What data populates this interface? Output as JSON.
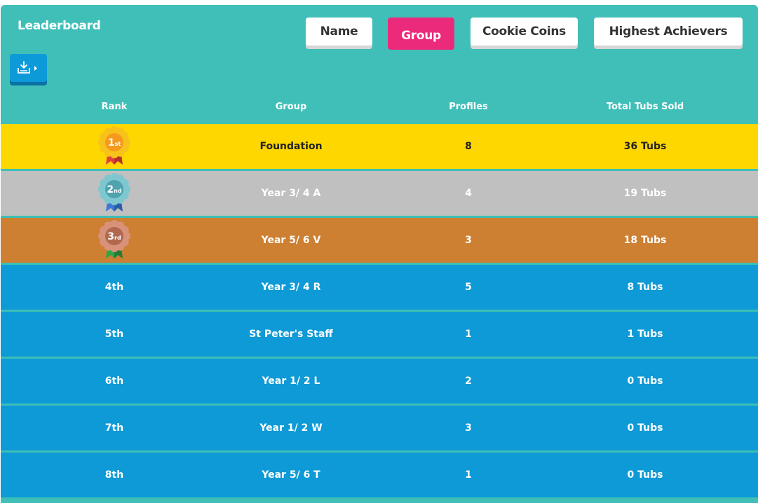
{
  "header": {
    "title": "Leaderboard"
  },
  "tabs": [
    {
      "label": "Name",
      "active": false
    },
    {
      "label": "Group",
      "active": true
    },
    {
      "label": "Cookie Coins",
      "active": false
    },
    {
      "label": "Highest Achievers",
      "active": false
    }
  ],
  "toolbar": {
    "export_icon": "download-tray-icon"
  },
  "table": {
    "columns": [
      "Rank",
      "Group",
      "Profiles",
      "Total Tubs Sold"
    ],
    "rows": [
      {
        "rank": "1st",
        "medal": "gold-medal-icon",
        "group": "Foundation",
        "profiles": "8",
        "tubs": "36 Tubs",
        "bg": "#ffd700",
        "text": "#222222"
      },
      {
        "rank": "2nd",
        "medal": "silver-medal-icon",
        "group": "Year 3/ 4 A",
        "profiles": "4",
        "tubs": "19 Tubs",
        "bg": "#c0c0c0",
        "text": "#ffffff"
      },
      {
        "rank": "3rd",
        "medal": "bronze-medal-icon",
        "group": "Year 5/ 6 V",
        "profiles": "3",
        "tubs": "18 Tubs",
        "bg": "#cd7f32",
        "text": "#ffffff"
      },
      {
        "rank": "4th",
        "group": "Year 3/ 4 R",
        "profiles": "5",
        "tubs": "8 Tubs",
        "bg": "#0d9ad6",
        "text": "#ffffff"
      },
      {
        "rank": "5th",
        "group": "St Peter's Staff",
        "profiles": "1",
        "tubs": "1 Tubs",
        "bg": "#0d9ad6",
        "text": "#ffffff"
      },
      {
        "rank": "6th",
        "group": "Year 1/ 2 L",
        "profiles": "2",
        "tubs": "0 Tubs",
        "bg": "#0d9ad6",
        "text": "#ffffff"
      },
      {
        "rank": "7th",
        "group": "Year 1/ 2 W",
        "profiles": "3",
        "tubs": "0 Tubs",
        "bg": "#0d9ad6",
        "text": "#ffffff"
      },
      {
        "rank": "8th",
        "group": "Year 5/ 6 T",
        "profiles": "1",
        "tubs": "0 Tubs",
        "bg": "#0d9ad6",
        "text": "#ffffff"
      }
    ]
  },
  "colors": {
    "panel": "#40bfb8",
    "active_tab": "#ec2a7b",
    "row_default": "#0d9ad6",
    "gold": "#ffd700",
    "silver": "#c0c0c0",
    "bronze": "#cd7f32"
  }
}
